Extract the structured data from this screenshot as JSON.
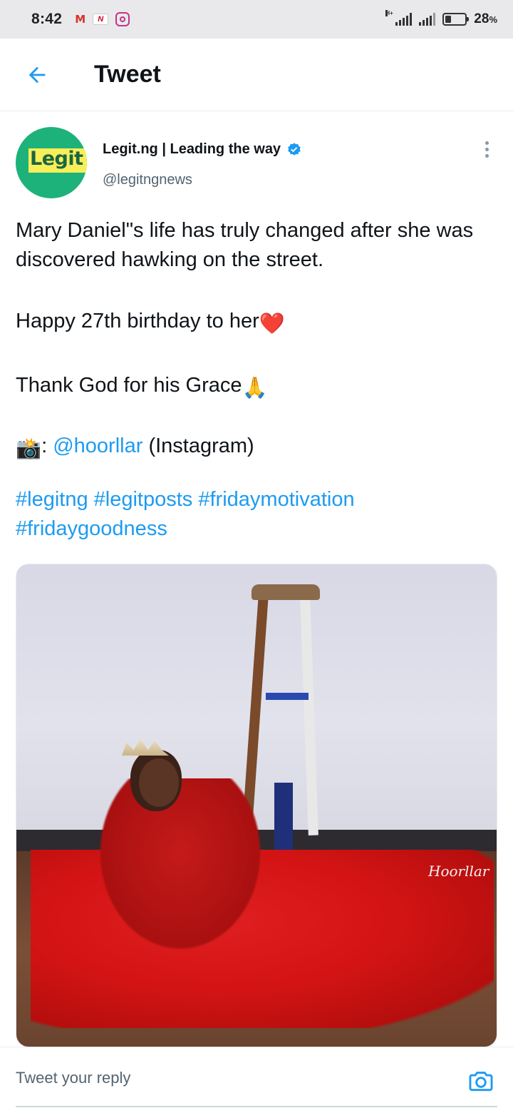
{
  "status_bar": {
    "time": "8:42",
    "apps": [
      "gmail-icon",
      "news-icon",
      "instagram-icon"
    ],
    "gmail_letter": "M",
    "news_letter": "N",
    "network_label": "H+",
    "battery_percent": "28",
    "battery_unit": "%"
  },
  "header": {
    "title": "Tweet",
    "back_icon": "arrow-left-icon"
  },
  "tweet": {
    "author": {
      "avatar_text": "Legit",
      "name": "Legit.ng | Leading the way",
      "handle": "@legitngnews",
      "verified": true
    },
    "paragraph1": "Mary Daniel\"s life has truly changed after she was discovered hawking on the street.",
    "paragraph2": "Happy 27th birthday to her",
    "paragraph2_emoji": "❤️",
    "paragraph3": "Thank God for his Grace",
    "paragraph3_emoji": "🙏",
    "credit_emoji": "📸",
    "credit_sep": ": ",
    "credit_mention": "@hoorllar",
    "credit_suffix": " (Instagram)",
    "hashtags": [
      "#legitng",
      "#legitposts",
      "#fridaymotivation",
      "#fridaygoodness"
    ],
    "image": {
      "watermark": "Hoorllar"
    }
  },
  "reply": {
    "placeholder": "Tweet your reply",
    "camera_icon": "camera-icon"
  },
  "colors": {
    "accent": "#1d9bf0",
    "text": "#0f1419",
    "secondary": "#536471",
    "status_bar_bg": "#e9e9ec",
    "avatar_bg": "#1db27a"
  }
}
